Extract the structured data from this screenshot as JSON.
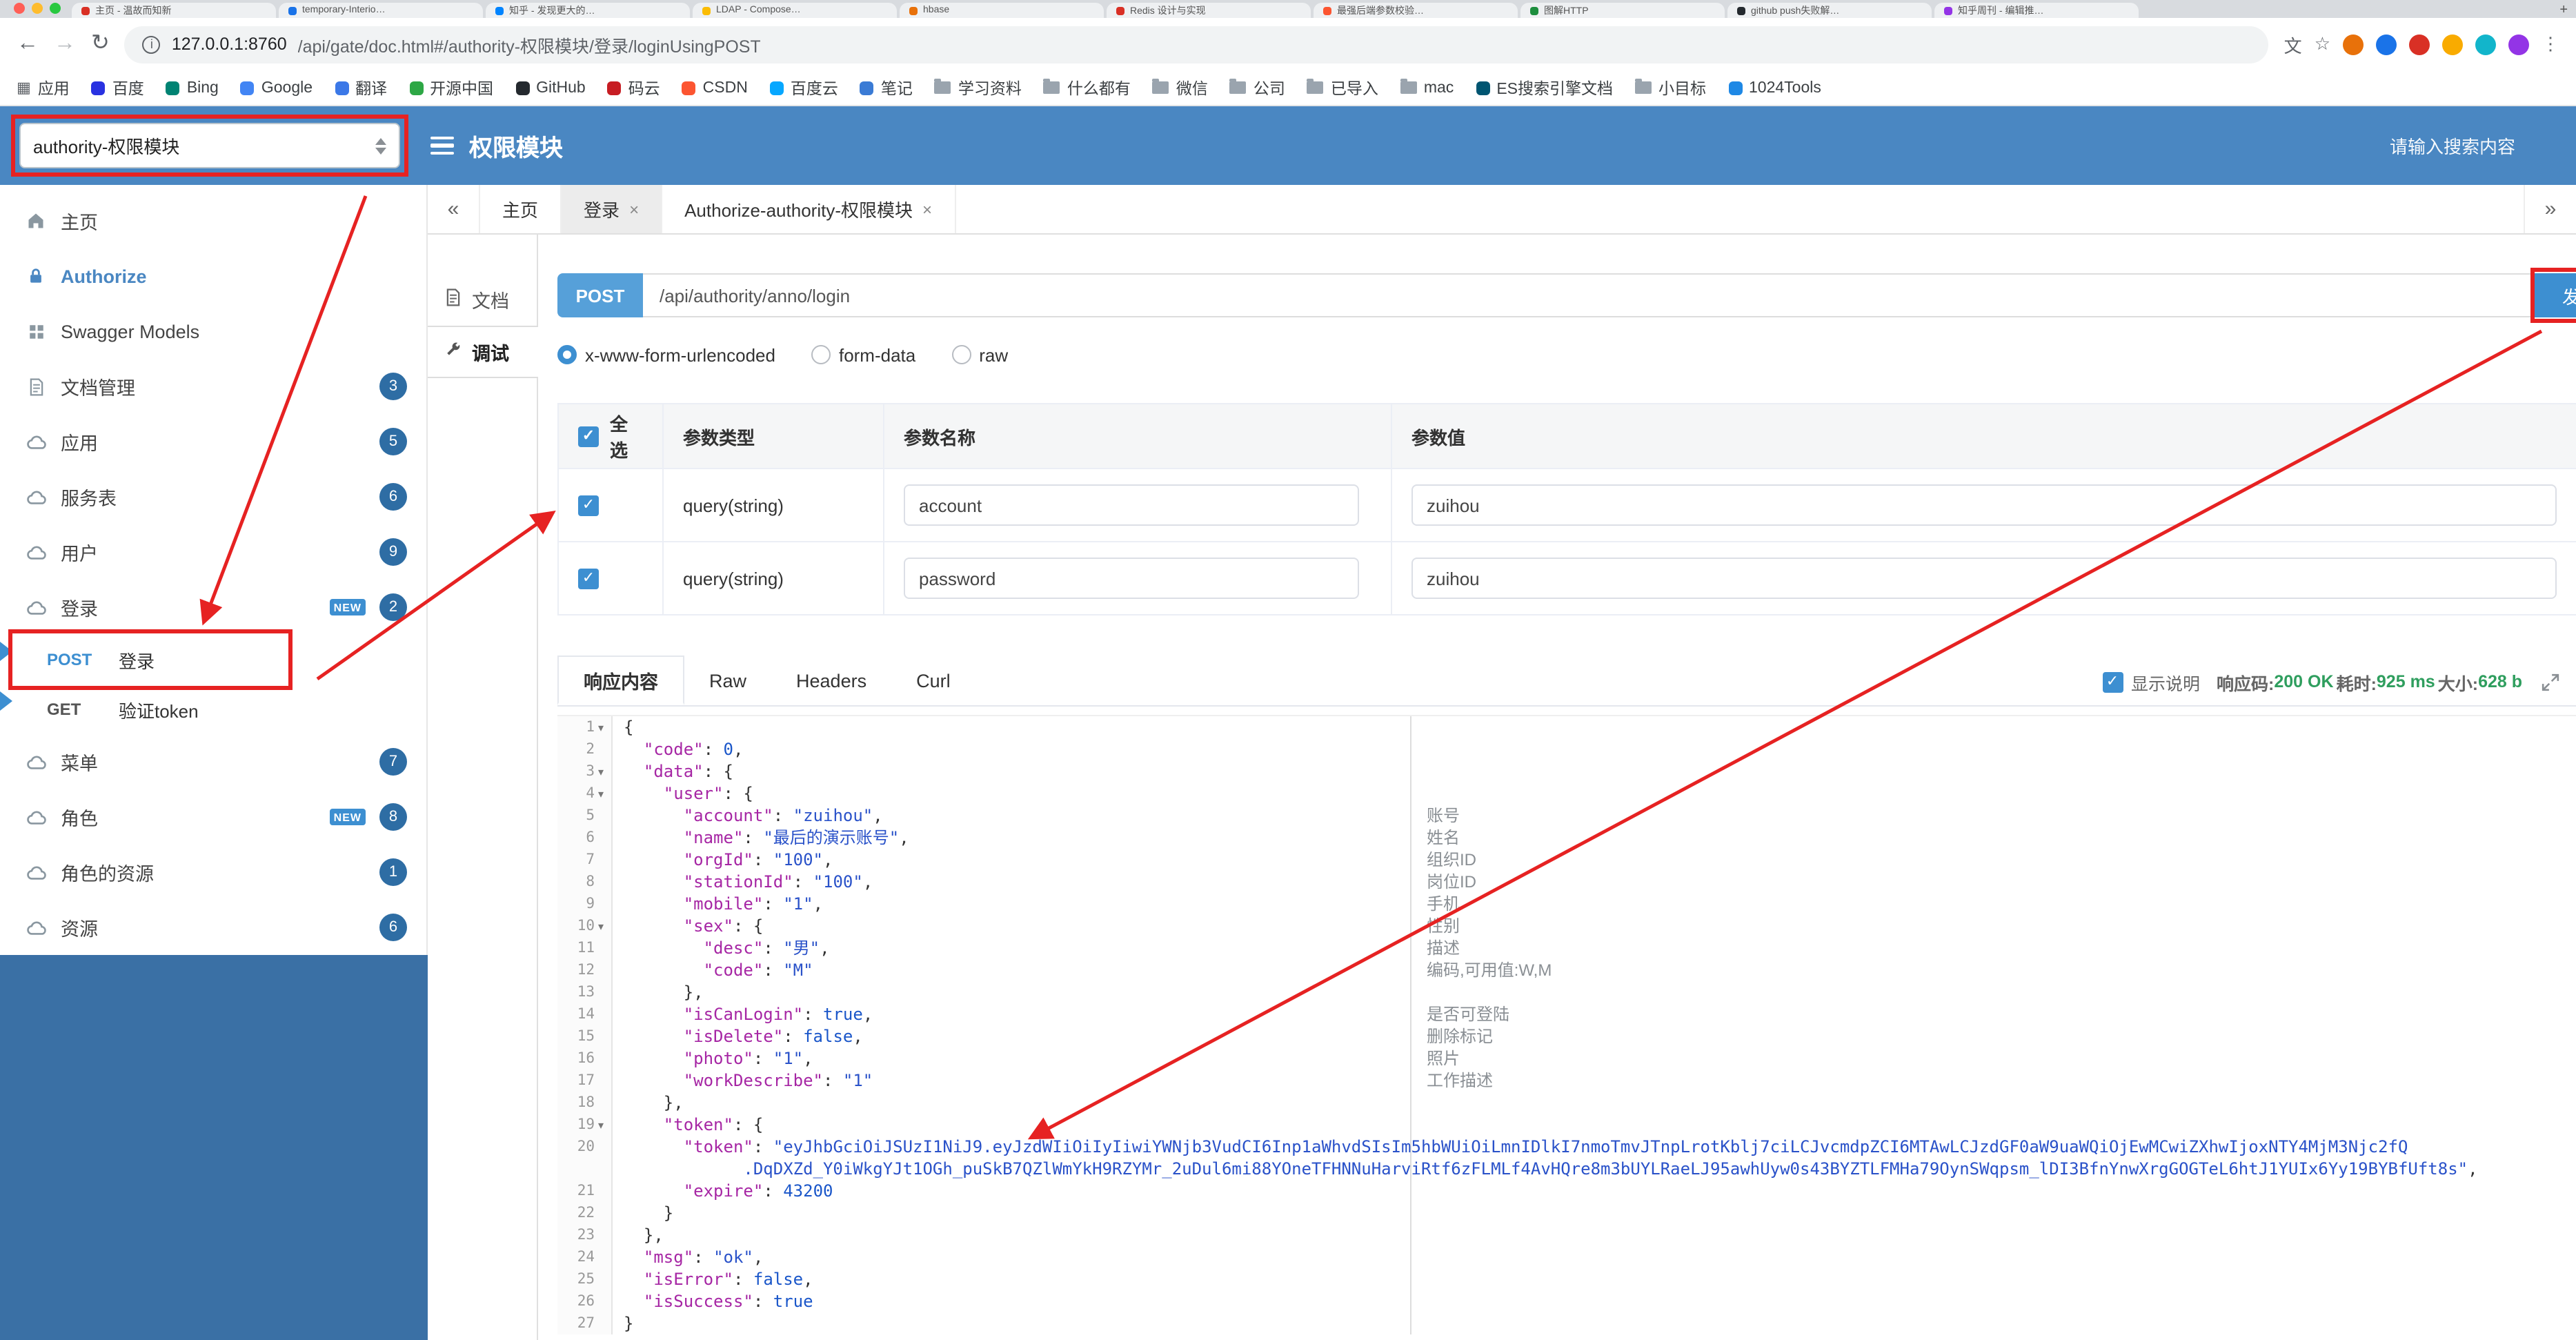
{
  "browser": {
    "traffic_lights": [
      "#ff5f57",
      "#febc2e",
      "#28c840"
    ],
    "tabs": [
      {
        "title": "主页 - 温故而知新",
        "favicon": "#d93025"
      },
      {
        "title": "temporary-Interio…",
        "favicon": "#1a73e8"
      },
      {
        "title": "知乎 - 发现更大的…",
        "favicon": "#0084ff"
      },
      {
        "title": "LDAP - Compose…",
        "favicon": "#fbbc04"
      },
      {
        "title": "hbase",
        "favicon": "#e8710a"
      },
      {
        "title": "Redis 设计与实现",
        "favicon": "#d93025"
      },
      {
        "title": "最强后端参数校验…",
        "favicon": "#fc5531"
      },
      {
        "title": "图解HTTP",
        "favicon": "#1e8e3e"
      },
      {
        "title": "github push失败解…",
        "favicon": "#24292e"
      },
      {
        "title": "知乎周刊 - 编辑推…",
        "favicon": "#9334e6"
      }
    ],
    "new_tab_label": "+",
    "nav": {
      "back": "←",
      "forward": "→",
      "reload": "↻"
    },
    "address": {
      "info": "i",
      "host": "127.0.0.1:8760",
      "path": "/api/gate/doc.html#/authority-权限模块/登录/loginUsingPOST"
    },
    "actions": [
      {
        "kind": "translate",
        "glyph": "文"
      },
      {
        "kind": "star",
        "glyph": "☆"
      },
      {
        "kind": "ext",
        "color": "#e8710a"
      },
      {
        "kind": "ext",
        "color": "#1a73e8"
      },
      {
        "kind": "ext",
        "color": "#d93025"
      },
      {
        "kind": "ext",
        "color": "#f9ab00"
      },
      {
        "kind": "ext",
        "color": "#12b5cb"
      },
      {
        "kind": "ext",
        "color": "#9334e6"
      },
      {
        "kind": "menu",
        "glyph": "⋮"
      }
    ],
    "bookmarks": [
      {
        "label": "应用",
        "icon": "apps"
      },
      {
        "label": "百度",
        "icon": "#2932e1"
      },
      {
        "label": "Bing",
        "icon": "#008373"
      },
      {
        "label": "Google",
        "icon": "#4285f4"
      },
      {
        "label": "翻译",
        "icon": "#3b78e7"
      },
      {
        "label": "开源中国",
        "icon": "#2da745"
      },
      {
        "label": "GitHub",
        "icon": "#24292e"
      },
      {
        "label": "码云",
        "icon": "#c71d23"
      },
      {
        "label": "CSDN",
        "icon": "#fc5531"
      },
      {
        "label": "百度云",
        "icon": "#06a7ff"
      },
      {
        "label": "笔记",
        "icon": "#3a7bd5"
      },
      {
        "label": "学习资料",
        "icon": "folder"
      },
      {
        "label": "什么都有",
        "icon": "folder"
      },
      {
        "label": "微信",
        "icon": "folder"
      },
      {
        "label": "公司",
        "icon": "folder"
      },
      {
        "label": "已导入",
        "icon": "folder"
      },
      {
        "label": "mac",
        "icon": "folder"
      },
      {
        "label": "ES搜索引擎文档",
        "icon": "#005571"
      },
      {
        "label": "小目标",
        "icon": "folder"
      },
      {
        "label": "1024Tools",
        "icon": "#1e88e5"
      }
    ]
  },
  "header": {
    "module_select": "authority-权限模块",
    "title": "权限模块",
    "search_placeholder": "请输入搜索内容"
  },
  "sidebar": {
    "items": [
      {
        "label": "主页",
        "icon": "home"
      },
      {
        "label": "Authorize",
        "icon": "lock",
        "active": true
      },
      {
        "label": "Swagger Models",
        "icon": "models"
      },
      {
        "label": "文档管理",
        "icon": "doc",
        "badge": "3"
      },
      {
        "label": "应用",
        "icon": "group",
        "badge": "5"
      },
      {
        "label": "服务表",
        "icon": "group",
        "badge": "6"
      },
      {
        "label": "用户",
        "icon": "group",
        "badge": "9"
      },
      {
        "label": "登录",
        "icon": "group",
        "badge": "2",
        "new_tag": "NEW"
      },
      {
        "label": "登录",
        "method": "POST",
        "endpoint": true
      },
      {
        "label": "验证token",
        "method": "GET",
        "endpoint": true
      },
      {
        "label": "菜单",
        "icon": "group",
        "badge": "7"
      },
      {
        "label": "角色",
        "icon": "group",
        "badge": "8",
        "new_tag": "NEW"
      },
      {
        "label": "角色的资源",
        "icon": "group",
        "badge": "1"
      },
      {
        "label": "资源",
        "icon": "group",
        "badge": "6"
      }
    ]
  },
  "page_tabs": {
    "collapse_left": "«",
    "collapse_right": "»",
    "items": [
      {
        "label": "主页"
      },
      {
        "label": "登录",
        "closable": true,
        "active": true
      },
      {
        "label": "Authorize-authority-权限模块",
        "closable": true
      }
    ]
  },
  "doc_tabs": [
    {
      "label": "文档",
      "icon": "docfile"
    },
    {
      "label": "调试",
      "icon": "debug",
      "active": true
    }
  ],
  "request": {
    "method": "POST",
    "url": "/api/authority/anno/login",
    "send_label": "发送",
    "content_types": [
      {
        "label": "x-www-form-urlencoded",
        "selected": true
      },
      {
        "label": "form-data"
      },
      {
        "label": "raw"
      }
    ]
  },
  "params_table": {
    "headers": [
      "全选",
      "参数类型",
      "参数名称",
      "参数值"
    ],
    "rows": [
      {
        "checked": true,
        "type": "query(string)",
        "name": "account",
        "value": "zuihou"
      },
      {
        "checked": true,
        "type": "query(string)",
        "name": "password",
        "value": "zuihou"
      }
    ]
  },
  "response": {
    "tabs": [
      {
        "label": "响应内容",
        "active": true
      },
      {
        "label": "Raw"
      },
      {
        "label": "Headers"
      },
      {
        "label": "Curl"
      }
    ],
    "show_desc_label": "显示说明",
    "meta": [
      {
        "label": "响应码:",
        "value": "200 OK"
      },
      {
        "label": "耗时:",
        "value": "925 ms"
      },
      {
        "label": "大小:",
        "value": "628 b"
      }
    ]
  },
  "code": {
    "lines": [
      {
        "n": "1",
        "f": true,
        "a": "",
        "s": [
          [
            "p",
            "{"
          ]
        ]
      },
      {
        "n": "2",
        "f": false,
        "a": "",
        "s": [
          [
            "k",
            "  \"code\""
          ],
          [
            "p",
            ": "
          ],
          [
            "n",
            "0"
          ],
          [
            "p",
            ","
          ]
        ]
      },
      {
        "n": "3",
        "f": true,
        "a": "",
        "s": [
          [
            "k",
            "  \"data\""
          ],
          [
            "p",
            ": {"
          ]
        ]
      },
      {
        "n": "4",
        "f": true,
        "a": "",
        "s": [
          [
            "k",
            "    \"user\""
          ],
          [
            "p",
            ": {"
          ]
        ]
      },
      {
        "n": "5",
        "f": false,
        "a": "账号",
        "s": [
          [
            "k",
            "      \"account\""
          ],
          [
            "p",
            ": "
          ],
          [
            "s",
            "\"zuihou\""
          ],
          [
            "p",
            ","
          ]
        ]
      },
      {
        "n": "6",
        "f": false,
        "a": "姓名",
        "s": [
          [
            "k",
            "      \"name\""
          ],
          [
            "p",
            ": "
          ],
          [
            "s",
            "\"最后的演示账号\""
          ],
          [
            "p",
            ","
          ]
        ]
      },
      {
        "n": "7",
        "f": false,
        "a": "组织ID",
        "s": [
          [
            "k",
            "      \"orgId\""
          ],
          [
            "p",
            ": "
          ],
          [
            "s",
            "\"100\""
          ],
          [
            "p",
            ","
          ]
        ]
      },
      {
        "n": "8",
        "f": false,
        "a": "岗位ID",
        "s": [
          [
            "k",
            "      \"stationId\""
          ],
          [
            "p",
            ": "
          ],
          [
            "s",
            "\"100\""
          ],
          [
            "p",
            ","
          ]
        ]
      },
      {
        "n": "9",
        "f": false,
        "a": "手机",
        "s": [
          [
            "k",
            "      \"mobile\""
          ],
          [
            "p",
            ": "
          ],
          [
            "s",
            "\"1\""
          ],
          [
            "p",
            ","
          ]
        ]
      },
      {
        "n": "10",
        "f": true,
        "a": "性别",
        "s": [
          [
            "k",
            "      \"sex\""
          ],
          [
            "p",
            ": {"
          ]
        ]
      },
      {
        "n": "11",
        "f": false,
        "a": "描述",
        "s": [
          [
            "k",
            "        \"desc\""
          ],
          [
            "p",
            ": "
          ],
          [
            "s",
            "\"男\""
          ],
          [
            "p",
            ","
          ]
        ]
      },
      {
        "n": "12",
        "f": false,
        "a": "编码,可用值:W,M",
        "s": [
          [
            "k",
            "        \"code\""
          ],
          [
            "p",
            ": "
          ],
          [
            "s",
            "\"M\""
          ]
        ]
      },
      {
        "n": "13",
        "f": false,
        "a": "",
        "s": [
          [
            "p",
            "      },"
          ]
        ]
      },
      {
        "n": "14",
        "f": false,
        "a": "是否可登陆",
        "s": [
          [
            "k",
            "      \"isCanLogin\""
          ],
          [
            "p",
            ": "
          ],
          [
            "b",
            "true"
          ],
          [
            "p",
            ","
          ]
        ]
      },
      {
        "n": "15",
        "f": false,
        "a": "删除标记",
        "s": [
          [
            "k",
            "      \"isDelete\""
          ],
          [
            "p",
            ": "
          ],
          [
            "b",
            "false"
          ],
          [
            "p",
            ","
          ]
        ]
      },
      {
        "n": "16",
        "f": false,
        "a": "照片",
        "s": [
          [
            "k",
            "      \"photo\""
          ],
          [
            "p",
            ": "
          ],
          [
            "s",
            "\"1\""
          ],
          [
            "p",
            ","
          ]
        ]
      },
      {
        "n": "17",
        "f": false,
        "a": "工作描述",
        "s": [
          [
            "k",
            "      \"workDescribe\""
          ],
          [
            "p",
            ": "
          ],
          [
            "s",
            "\"1\""
          ]
        ]
      },
      {
        "n": "18",
        "f": false,
        "a": "",
        "s": [
          [
            "p",
            "    },"
          ]
        ]
      },
      {
        "n": "19",
        "f": true,
        "a": "",
        "s": [
          [
            "k",
            "    \"token\""
          ],
          [
            "p",
            ": {"
          ]
        ]
      },
      {
        "n": "20",
        "f": false,
        "a": "",
        "s": [
          [
            "k",
            "      \"token\""
          ],
          [
            "p",
            ": "
          ],
          [
            "s",
            "\"eyJhbGciOiJSUzI1NiJ9.eyJzdWIiOiIyIiwiYWNjb3VudCI6Inp1aWhvdSIsIm5hbWUiOiLmnIDlkI7nmoTmvJTnpLrotKblj7ciLCJvcmdpZCI6MTAwLCJzdGF0aW9uaWQiOjEwMCwiZXhwIjoxNTY4MjM3Njc2fQ"
          ]
        ]
      },
      {
        "n": "",
        "f": false,
        "a": "",
        "s": [
          [
            "s",
            "            .DqDXZd_Y0iWkgYJt1OGh_puSkB7QZlWmYkH9RZYMr_2uDul6mi88YOneTFHNNuHarviRtf6zFLMLf4AvHQre8m3bUYLRaeLJ95awhUyw0s43BYZTLFMHa79OynSWqpsm_lDI3BfnYnwXrgGOGTeL6htJ1YUIx6Yy19BYBfUft8s\""
          ],
          [
            "p",
            ","
          ]
        ]
      },
      {
        "n": "21",
        "f": false,
        "a": "",
        "s": [
          [
            "k",
            "      \"expire\""
          ],
          [
            "p",
            ": "
          ],
          [
            "n",
            "43200"
          ]
        ]
      },
      {
        "n": "22",
        "f": false,
        "a": "",
        "s": [
          [
            "p",
            "    }"
          ]
        ]
      },
      {
        "n": "23",
        "f": false,
        "a": "",
        "s": [
          [
            "p",
            "  },"
          ]
        ]
      },
      {
        "n": "24",
        "f": false,
        "a": "",
        "s": [
          [
            "k",
            "  \"msg\""
          ],
          [
            "p",
            ": "
          ],
          [
            "s",
            "\"ok\""
          ],
          [
            "p",
            ","
          ]
        ]
      },
      {
        "n": "25",
        "f": false,
        "a": "",
        "s": [
          [
            "k",
            "  \"isError\""
          ],
          [
            "p",
            ": "
          ],
          [
            "b",
            "false"
          ],
          [
            "p",
            ","
          ]
        ]
      },
      {
        "n": "26",
        "f": false,
        "a": "",
        "s": [
          [
            "k",
            "  \"isSuccess\""
          ],
          [
            "p",
            ": "
          ],
          [
            "b",
            "true"
          ]
        ]
      },
      {
        "n": "27",
        "f": false,
        "a": "",
        "s": [
          [
            "p",
            "}"
          ]
        ]
      }
    ]
  }
}
